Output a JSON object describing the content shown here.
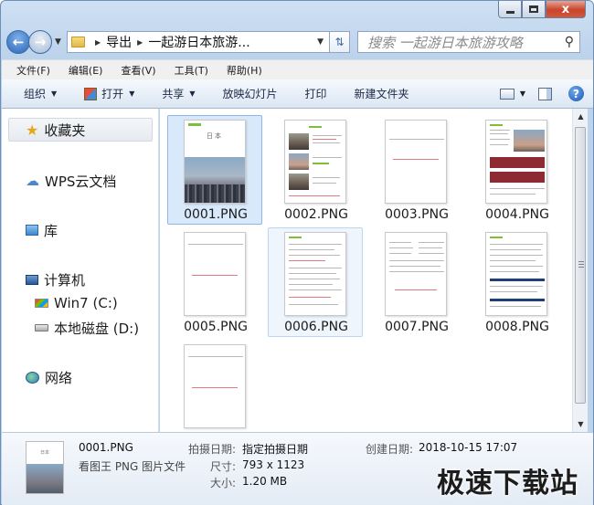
{
  "window": {
    "caption": {
      "minimize": "",
      "maximize": "",
      "close": "x"
    }
  },
  "nav": {
    "address_crumbs": [
      "导出",
      "一起游日本旅游..."
    ],
    "search_placeholder": "搜索 一起游日本旅游攻略"
  },
  "menu": [
    "文件(F)",
    "编辑(E)",
    "查看(V)",
    "工具(T)",
    "帮助(H)"
  ],
  "toolbar": {
    "organize": "组织",
    "open": "打开",
    "share": "共享",
    "slideshow": "放映幻灯片",
    "print": "打印",
    "new_folder": "新建文件夹",
    "help": "?"
  },
  "sidebar": {
    "favorites": "收藏夹",
    "wps": "WPS云文档",
    "library": "库",
    "computer": "计算机",
    "drive_c": "Win7 (C:)",
    "drive_d": "本地磁盘 (D:)",
    "network": "网络"
  },
  "files": [
    {
      "name": "0001.PNG",
      "state": "selected"
    },
    {
      "name": "0002.PNG",
      "state": ""
    },
    {
      "name": "0003.PNG",
      "state": ""
    },
    {
      "name": "0004.PNG",
      "state": ""
    },
    {
      "name": "0005.PNG",
      "state": ""
    },
    {
      "name": "0006.PNG",
      "state": "hover"
    },
    {
      "name": "0007.PNG",
      "state": ""
    },
    {
      "name": "0008.PNG",
      "state": ""
    },
    {
      "name": "",
      "state": ""
    }
  ],
  "thumbnail_text": {
    "cover_title": "日本"
  },
  "details": {
    "name": "0001.PNG",
    "type": "看图王 PNG 图片文件",
    "taken_label": "拍摄日期:",
    "taken_value": "指定拍摄日期",
    "dim_label": "尺寸:",
    "dim_value": "793 x 1123",
    "size_label": "大小:",
    "size_value": "1.20 MB",
    "created_label": "创建日期:",
    "created_value": "2018-10-15 17:07"
  },
  "watermark": "极速下载站"
}
